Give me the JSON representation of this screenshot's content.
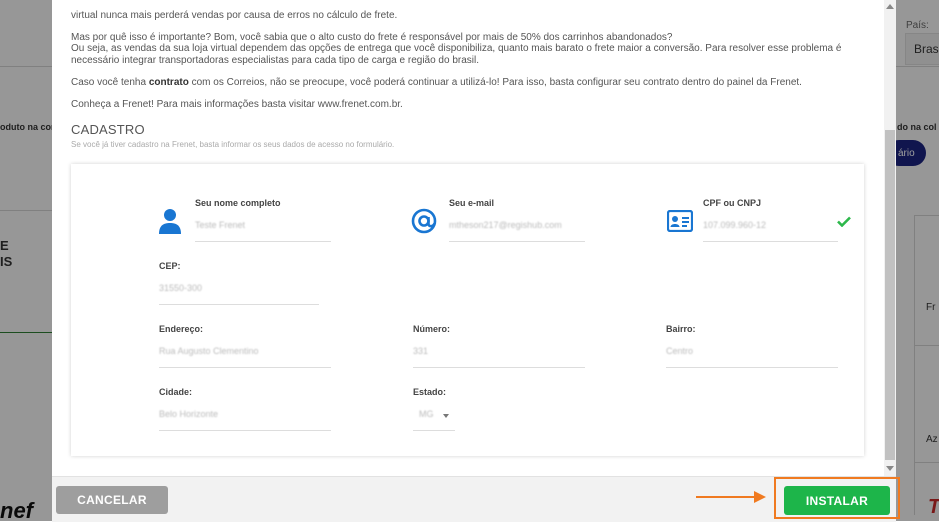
{
  "background": {
    "pais_label": "País:",
    "pais_value": "Bras",
    "left_text_1": "oduto na con",
    "left_text_2": "E",
    "left_text_3": "IS",
    "left_text_4": "nef",
    "right_text_1": "do na col",
    "right_text_2": "ário",
    "right_text_3": "Fr",
    "right_text_4": "Az",
    "right_text_5": "T"
  },
  "intro": {
    "paragraph_top": "virtual nunca mais perderá vendas por causa de erros no cálculo de frete.",
    "paragraph_why_1": "Mas por quê isso é importante? Bom, você sabia que o alto custo do frete é responsável por mais de 50% dos carrinhos abandonados?",
    "paragraph_why_2": "Ou seja, as vendas da sua loja virtual dependem das opções de entrega que você disponibiliza, quanto mais barato o frete maior a conversão. Para resolver esse problema é necessário integrar transportadoras especialistas para cada tipo de carga e região do brasil.",
    "contract_before": "Caso você tenha ",
    "contract_bold": "contrato",
    "contract_after": " com os Correios, não se preocupe, você poderá continuar a utilizá-lo! Para isso, basta configurar seu contrato dentro do painel da Frenet.",
    "frenet_link": "Conheça a Frenet! Para mais informações basta visitar www.frenet.com.br."
  },
  "cadastro": {
    "title": "CADASTRO",
    "subtitle": "Se você já tiver cadastro na Frenet, basta informar os seus dados de acesso no formulário.",
    "fields": {
      "name": {
        "label": "Seu nome completo",
        "value": "Teste Frenet"
      },
      "email": {
        "label": "Seu e-mail",
        "value": "mtheson217@regishub.com"
      },
      "cpf": {
        "label": "CPF ou CNPJ",
        "value": "107.099.960-12"
      },
      "cep": {
        "label": "CEP:",
        "value": "31550-300"
      },
      "endereco": {
        "label": "Endereço:",
        "value": "Rua Augusto Clementino"
      },
      "numero": {
        "label": "Número:",
        "value": "331"
      },
      "bairro": {
        "label": "Bairro:",
        "value": "Centro"
      },
      "cidade": {
        "label": "Cidade:",
        "value": "Belo Horizonte"
      },
      "estado": {
        "label": "Estado:",
        "value": "MG"
      }
    }
  },
  "footer": {
    "cancel_label": "CANCELAR",
    "install_label": "INSTALAR"
  },
  "colors": {
    "icon_blue": "#1976d2",
    "install_green": "#1db54a",
    "highlight_orange": "#f07a20",
    "check_green": "#2db84b"
  }
}
